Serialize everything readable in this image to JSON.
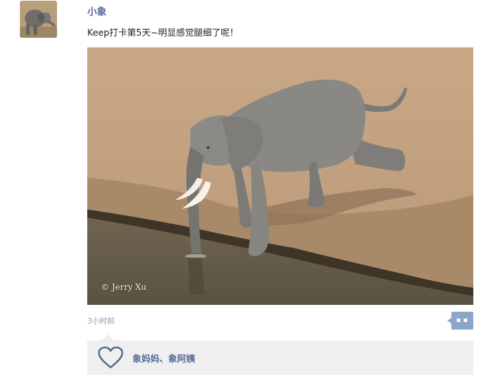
{
  "post": {
    "username": "小象",
    "text": "Keep打卡第5天~明显感觉腿细了呢！",
    "photo_watermark": "© Jerry Xu",
    "timestamp": "3小时前"
  },
  "likes": {
    "names": "象妈妈、象阿姨"
  },
  "icons": {
    "like": "heart-icon",
    "comment": "comment-bubble-icon"
  },
  "colors": {
    "link": "#576b95",
    "comment_button": "#8aa6c8",
    "likes_panel_bg": "#efefef",
    "timestamp": "#9a9a9a"
  }
}
